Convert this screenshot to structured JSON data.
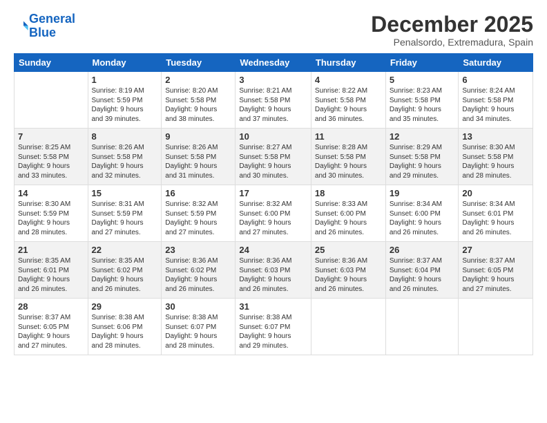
{
  "logo": {
    "line1": "General",
    "line2": "Blue"
  },
  "title": "December 2025",
  "subtitle": "Penalsordo, Extremadura, Spain",
  "weekdays": [
    "Sunday",
    "Monday",
    "Tuesday",
    "Wednesday",
    "Thursday",
    "Friday",
    "Saturday"
  ],
  "weeks": [
    [
      {
        "day": "",
        "info": ""
      },
      {
        "day": "1",
        "info": "Sunrise: 8:19 AM\nSunset: 5:59 PM\nDaylight: 9 hours\nand 39 minutes."
      },
      {
        "day": "2",
        "info": "Sunrise: 8:20 AM\nSunset: 5:58 PM\nDaylight: 9 hours\nand 38 minutes."
      },
      {
        "day": "3",
        "info": "Sunrise: 8:21 AM\nSunset: 5:58 PM\nDaylight: 9 hours\nand 37 minutes."
      },
      {
        "day": "4",
        "info": "Sunrise: 8:22 AM\nSunset: 5:58 PM\nDaylight: 9 hours\nand 36 minutes."
      },
      {
        "day": "5",
        "info": "Sunrise: 8:23 AM\nSunset: 5:58 PM\nDaylight: 9 hours\nand 35 minutes."
      },
      {
        "day": "6",
        "info": "Sunrise: 8:24 AM\nSunset: 5:58 PM\nDaylight: 9 hours\nand 34 minutes."
      }
    ],
    [
      {
        "day": "7",
        "info": "Sunrise: 8:25 AM\nSunset: 5:58 PM\nDaylight: 9 hours\nand 33 minutes."
      },
      {
        "day": "8",
        "info": "Sunrise: 8:26 AM\nSunset: 5:58 PM\nDaylight: 9 hours\nand 32 minutes."
      },
      {
        "day": "9",
        "info": "Sunrise: 8:26 AM\nSunset: 5:58 PM\nDaylight: 9 hours\nand 31 minutes."
      },
      {
        "day": "10",
        "info": "Sunrise: 8:27 AM\nSunset: 5:58 PM\nDaylight: 9 hours\nand 30 minutes."
      },
      {
        "day": "11",
        "info": "Sunrise: 8:28 AM\nSunset: 5:58 PM\nDaylight: 9 hours\nand 30 minutes."
      },
      {
        "day": "12",
        "info": "Sunrise: 8:29 AM\nSunset: 5:58 PM\nDaylight: 9 hours\nand 29 minutes."
      },
      {
        "day": "13",
        "info": "Sunrise: 8:30 AM\nSunset: 5:58 PM\nDaylight: 9 hours\nand 28 minutes."
      }
    ],
    [
      {
        "day": "14",
        "info": "Sunrise: 8:30 AM\nSunset: 5:59 PM\nDaylight: 9 hours\nand 28 minutes."
      },
      {
        "day": "15",
        "info": "Sunrise: 8:31 AM\nSunset: 5:59 PM\nDaylight: 9 hours\nand 27 minutes."
      },
      {
        "day": "16",
        "info": "Sunrise: 8:32 AM\nSunset: 5:59 PM\nDaylight: 9 hours\nand 27 minutes."
      },
      {
        "day": "17",
        "info": "Sunrise: 8:32 AM\nSunset: 6:00 PM\nDaylight: 9 hours\nand 27 minutes."
      },
      {
        "day": "18",
        "info": "Sunrise: 8:33 AM\nSunset: 6:00 PM\nDaylight: 9 hours\nand 26 minutes."
      },
      {
        "day": "19",
        "info": "Sunrise: 8:34 AM\nSunset: 6:00 PM\nDaylight: 9 hours\nand 26 minutes."
      },
      {
        "day": "20",
        "info": "Sunrise: 8:34 AM\nSunset: 6:01 PM\nDaylight: 9 hours\nand 26 minutes."
      }
    ],
    [
      {
        "day": "21",
        "info": "Sunrise: 8:35 AM\nSunset: 6:01 PM\nDaylight: 9 hours\nand 26 minutes."
      },
      {
        "day": "22",
        "info": "Sunrise: 8:35 AM\nSunset: 6:02 PM\nDaylight: 9 hours\nand 26 minutes."
      },
      {
        "day": "23",
        "info": "Sunrise: 8:36 AM\nSunset: 6:02 PM\nDaylight: 9 hours\nand 26 minutes."
      },
      {
        "day": "24",
        "info": "Sunrise: 8:36 AM\nSunset: 6:03 PM\nDaylight: 9 hours\nand 26 minutes."
      },
      {
        "day": "25",
        "info": "Sunrise: 8:36 AM\nSunset: 6:03 PM\nDaylight: 9 hours\nand 26 minutes."
      },
      {
        "day": "26",
        "info": "Sunrise: 8:37 AM\nSunset: 6:04 PM\nDaylight: 9 hours\nand 26 minutes."
      },
      {
        "day": "27",
        "info": "Sunrise: 8:37 AM\nSunset: 6:05 PM\nDaylight: 9 hours\nand 27 minutes."
      }
    ],
    [
      {
        "day": "28",
        "info": "Sunrise: 8:37 AM\nSunset: 6:05 PM\nDaylight: 9 hours\nand 27 minutes."
      },
      {
        "day": "29",
        "info": "Sunrise: 8:38 AM\nSunset: 6:06 PM\nDaylight: 9 hours\nand 28 minutes."
      },
      {
        "day": "30",
        "info": "Sunrise: 8:38 AM\nSunset: 6:07 PM\nDaylight: 9 hours\nand 28 minutes."
      },
      {
        "day": "31",
        "info": "Sunrise: 8:38 AM\nSunset: 6:07 PM\nDaylight: 9 hours\nand 29 minutes."
      },
      {
        "day": "",
        "info": ""
      },
      {
        "day": "",
        "info": ""
      },
      {
        "day": "",
        "info": ""
      }
    ]
  ]
}
